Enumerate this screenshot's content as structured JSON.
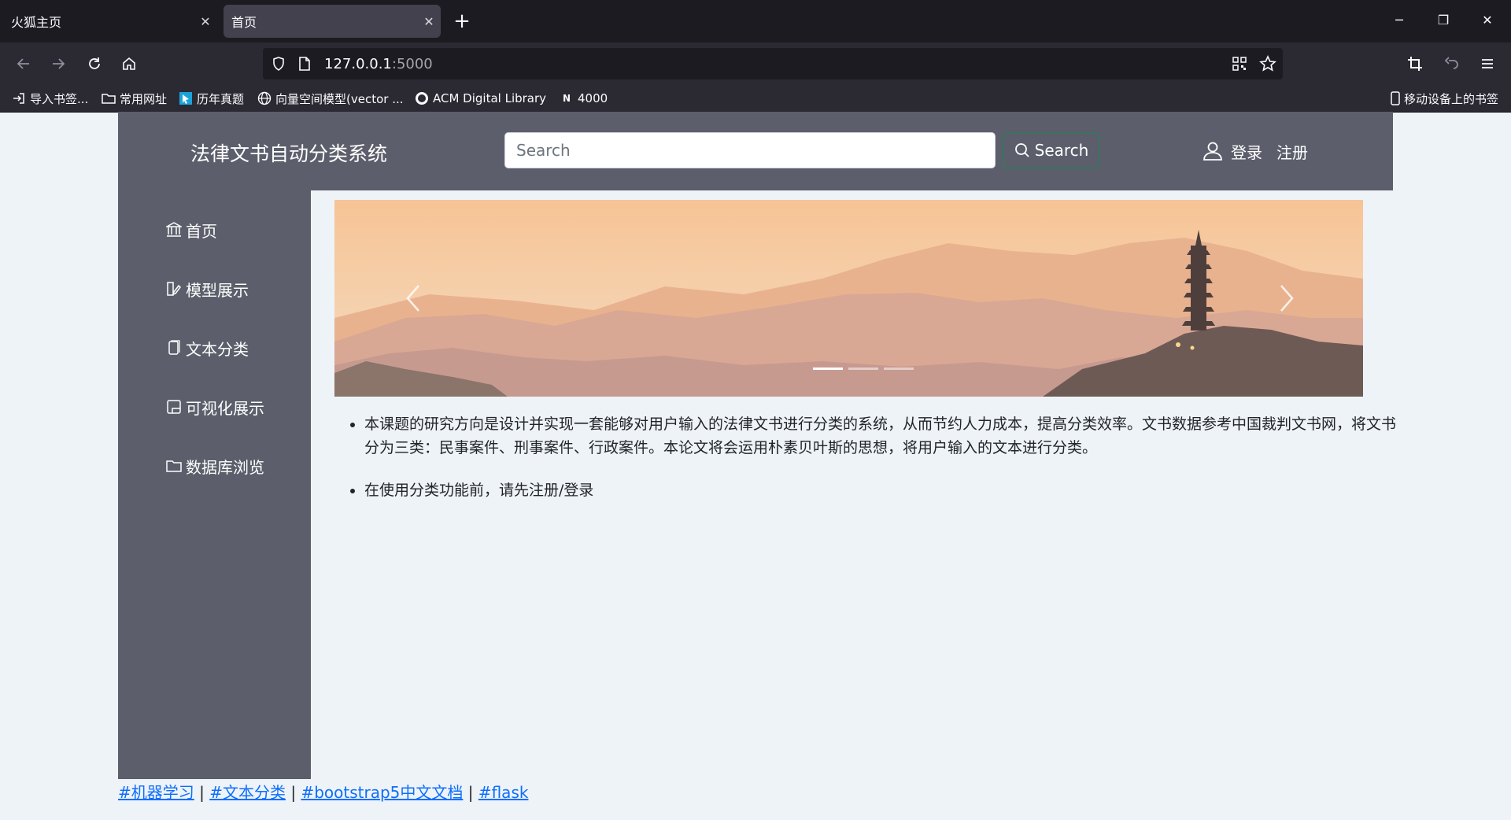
{
  "browser": {
    "tabs": [
      {
        "label": "火狐主页",
        "active": false
      },
      {
        "label": "首页",
        "active": true
      }
    ],
    "new_tab": "+",
    "window_controls": {
      "minimize": "─",
      "restore": "❐",
      "close": "✕"
    },
    "url": {
      "host": "127.0.0.1",
      "port": ":5000"
    },
    "bookmarks": [
      {
        "label": "导入书签...",
        "icon": "import-icon"
      },
      {
        "label": "常用网址",
        "icon": "folder-icon"
      },
      {
        "label": "历年真题",
        "icon": "site-icon"
      },
      {
        "label": "向量空间模型(vector ...",
        "icon": "globe-icon"
      },
      {
        "label": "ACM Digital Library",
        "icon": "acm-icon"
      },
      {
        "label": "4000",
        "icon": "n-icon"
      }
    ],
    "mobile_bookmarks": "移动设备上的书签"
  },
  "header": {
    "title": "法律文书自动分类系统",
    "search_placeholder": "Search",
    "search_button": "Search",
    "login": "登录",
    "register": "注册"
  },
  "sidebar": {
    "items": [
      {
        "label": "首页",
        "icon": "bank-icon"
      },
      {
        "label": "模型展示",
        "icon": "model-icon"
      },
      {
        "label": "文本分类",
        "icon": "document-icon"
      },
      {
        "label": "可视化展示",
        "icon": "chart-doc-icon"
      },
      {
        "label": "数据库浏览",
        "icon": "folder-icon"
      }
    ]
  },
  "carousel": {
    "slides": 3,
    "active_slide": 0
  },
  "content": {
    "paragraphs": [
      "本课题的研究方向是设计并实现一套能够对用户输入的法律文书进行分类的系统，从而节约人力成本，提高分类效率。文书数据参考中国裁判文书网，将文书分为三类：民事案件、刑事案件、行政案件。本论文将会运用朴素贝叶斯的思想，将用户输入的文本进行分类。",
      "在使用分类功能前，请先注册/登录"
    ]
  },
  "footer": {
    "links": [
      "#机器学习",
      "#文本分类",
      "#bootstrap5中文文档",
      "#flask"
    ],
    "separator": " | "
  },
  "colors": {
    "chrome_dark": "#1c1b22",
    "chrome_mid": "#2b2a33",
    "panel": "#5c5f6b",
    "page_bg": "#eef3f7",
    "link": "#0d6efd",
    "success_border": "#198754"
  }
}
